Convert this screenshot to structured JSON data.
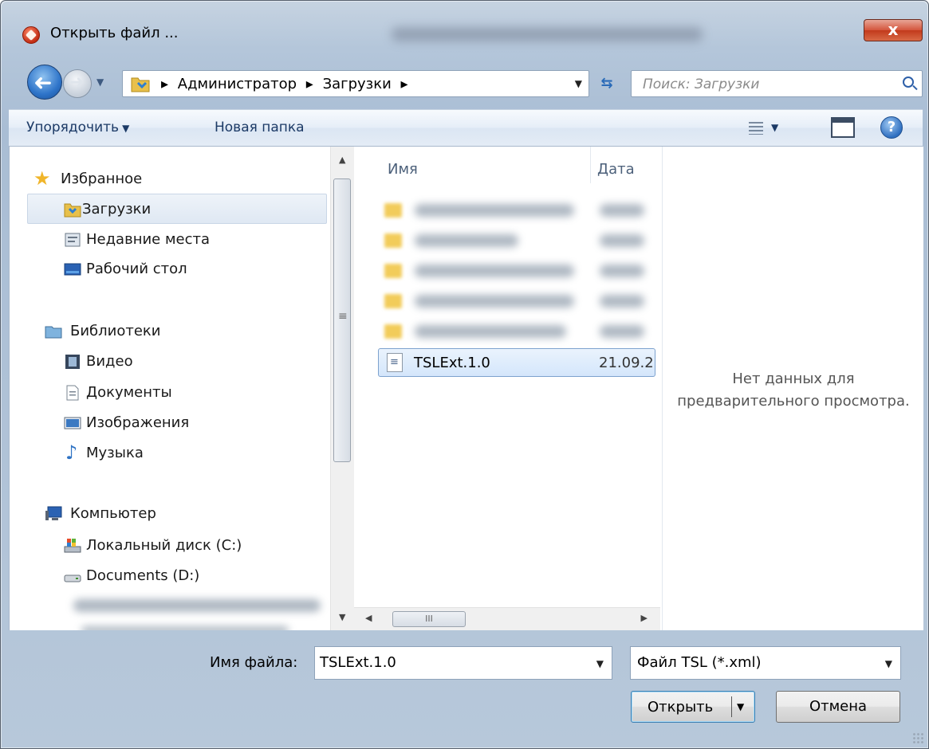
{
  "window": {
    "title": "Открыть файл ...",
    "close_label": "x"
  },
  "address_bar": {
    "crumbs": [
      "Администратор",
      "Загрузки"
    ]
  },
  "search": {
    "placeholder": "Поиск: Загрузки"
  },
  "toolbar": {
    "organize_label": "Упорядочить",
    "new_folder_label": "Новая папка"
  },
  "nav_pane": {
    "favorites": {
      "header": "Избранное",
      "items": [
        "Загрузки",
        "Недавние места",
        "Рабочий стол"
      ]
    },
    "libraries": {
      "header": "Библиотеки",
      "items": [
        "Видео",
        "Документы",
        "Изображения",
        "Музыка"
      ]
    },
    "computer": {
      "header": "Компьютер",
      "items": [
        "Локальный диск (C:)",
        "Documents (D:)"
      ]
    }
  },
  "file_list": {
    "columns": [
      "Имя",
      "Дата"
    ],
    "selected_file": {
      "name": "TSLExt.1.0",
      "date": "21.09.2"
    }
  },
  "preview": {
    "message_line1": "Нет данных для",
    "message_line2": "предварительного просмотра."
  },
  "bottom": {
    "filename_label": "Имя файла:",
    "filename_value": "TSLExt.1.0",
    "filetype_value": "Файл TSL (*.xml)",
    "open_label": "Открыть",
    "cancel_label": "Отмена"
  },
  "icons": {
    "app": "app-icon",
    "back": "back-arrow-icon",
    "forward": "forward-arrow-icon",
    "refresh": "refresh-icon",
    "search": "search-icon",
    "views": "views-icon",
    "preview_pane": "preview-pane-icon",
    "help": "help-icon"
  }
}
